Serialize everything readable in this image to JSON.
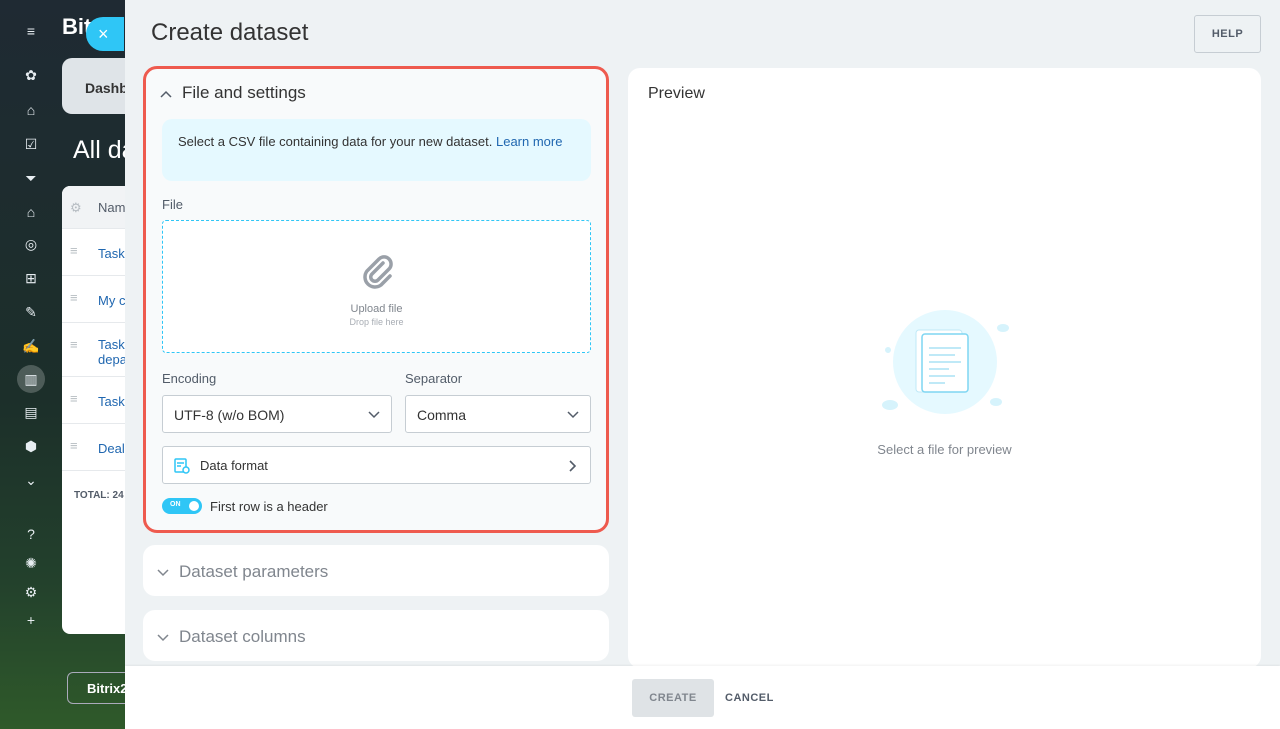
{
  "background": {
    "logo": "Bit",
    "tab_label": "Dashb",
    "title": "All da",
    "grid_header": "Nam",
    "rows": [
      "Task",
      "My c",
      "Task\ndepa",
      "Task",
      "Deal"
    ],
    "total": "TOTAL: 24",
    "bottom_button": "Bitrix2"
  },
  "slider": {
    "title": "Create dataset",
    "help": "HELP",
    "file_section": {
      "heading": "File and settings",
      "info_text": "Select a CSV file containing data for your new dataset.",
      "info_link": "Learn more",
      "file_label": "File",
      "upload_text": "Upload file",
      "drop_text": "Drop file here",
      "encoding_label": "Encoding",
      "encoding_value": "UTF-8 (w/o BOM)",
      "separator_label": "Separator",
      "separator_value": "Comma",
      "data_format": "Data format",
      "toggle_state": "ON",
      "toggle_label": "First row is a header"
    },
    "params_heading": "Dataset parameters",
    "columns_heading": "Dataset columns",
    "preview": {
      "title": "Preview",
      "empty_text": "Select a file for preview"
    },
    "footer": {
      "create": "CREATE",
      "cancel": "CANCEL"
    }
  },
  "colors": {
    "accent": "#2fc6f6",
    "highlight_border": "#ee5a4e",
    "link": "#2067b0"
  }
}
